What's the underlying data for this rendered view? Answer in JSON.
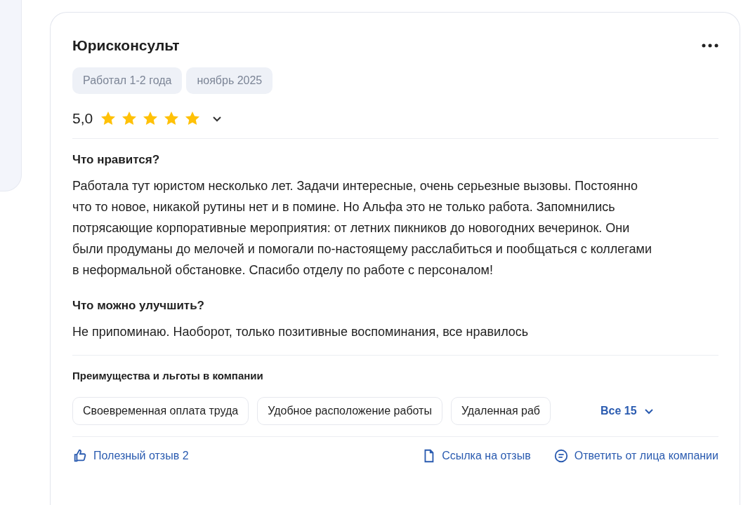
{
  "review": {
    "title": "Юрисконсульт",
    "tags": [
      "Работал 1-2 года",
      "ноябрь 2025"
    ],
    "rating": "5,0",
    "stars": 5,
    "sections": [
      {
        "heading": "Что нравится?",
        "text": "Работала тут юристом несколько лет. Задачи интересные, очень серьезные вызовы. Постоянно что то новое, никакой рутины нет и в помине. Но Альфа это не только работа. Запомнились потрясающие корпоративные мероприятия: от летних пикников до новогодних вечеринок. Они были продуманы до мелочей и помогали по-настоящему расслабиться и пообщаться с коллегами в неформальной обстановке. Спасибо отделу по работе с персоналом!"
      },
      {
        "heading": "Что можно улучшить?",
        "text": "Не припоминаю. Наоборот, только позитивные воспоминания, все нравилось"
      }
    ],
    "benefits": {
      "heading": "Преимущества и льготы в компании",
      "items": [
        "Своевременная оплата труда",
        "Удобное расположение работы",
        "Удаленная раб"
      ],
      "more": "Все 15"
    },
    "actions": [
      {
        "kind": "like",
        "label": "Полезный отзыв 2"
      },
      {
        "kind": "link",
        "label": "Ссылка на отзыв"
      },
      {
        "kind": "reply",
        "label": "Ответить от лица компании"
      }
    ]
  }
}
